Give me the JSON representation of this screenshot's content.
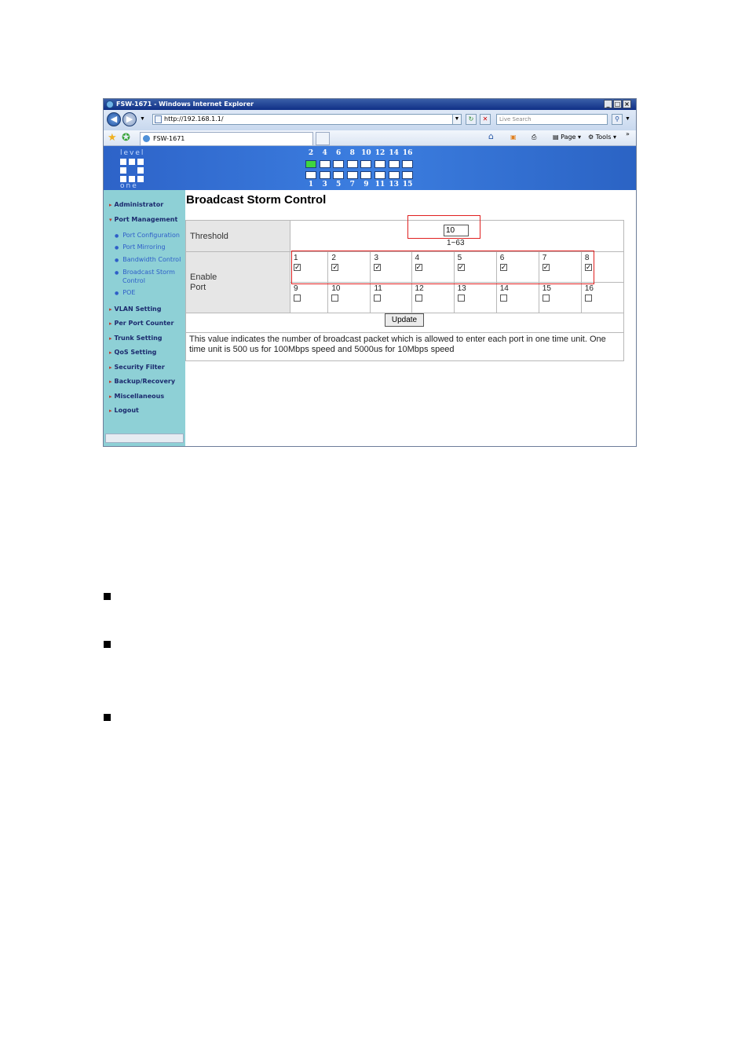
{
  "window": {
    "title": "FSW-1671 - Windows Internet Explorer",
    "url": "http://192.168.1.1/",
    "search_placeholder": "Live Search",
    "tab_title": "FSW-1671",
    "toolbar": {
      "page_label": "Page",
      "tools_label": "Tools"
    },
    "controls": {
      "minimize": "_",
      "maximize": "□",
      "close": "×"
    }
  },
  "banner": {
    "logo_top": "level",
    "logo_bottom": "one",
    "top_port_numbers": [
      "2",
      "4",
      "6",
      "8",
      "10",
      "12",
      "14",
      "16"
    ],
    "bottom_port_numbers": [
      "1",
      "3",
      "5",
      "7",
      "9",
      "11",
      "13",
      "15"
    ],
    "active_port": "2"
  },
  "sidebar": {
    "administrator": "Administrator",
    "port_management": "Port Management",
    "submenu": {
      "port_configuration": "Port Configuration",
      "port_mirroring": "Port Mirroring",
      "bandwidth_control": "Bandwidth Control",
      "broadcast_storm_1": "Broadcast Storm",
      "broadcast_storm_2": "Control",
      "poe": "POE"
    },
    "vlan_setting": "VLAN Setting",
    "per_port_counter": "Per Port Counter",
    "trunk_setting": "Trunk Setting",
    "qos_setting": "QoS Setting",
    "security_filter": "Security Filter",
    "backup_recovery": "Backup/Recovery",
    "miscellaneous": "Miscellaneous",
    "logout": "Logout"
  },
  "main": {
    "title": "Broadcast Storm Control",
    "threshold_label": "Threshold",
    "threshold_value": "10",
    "threshold_range": "1~63",
    "enable_port_label_1": "Enable",
    "enable_port_label_2": "Port",
    "ports_row1": [
      {
        "num": "1",
        "checked": true
      },
      {
        "num": "2",
        "checked": true
      },
      {
        "num": "3",
        "checked": true
      },
      {
        "num": "4",
        "checked": true
      },
      {
        "num": "5",
        "checked": true
      },
      {
        "num": "6",
        "checked": true
      },
      {
        "num": "7",
        "checked": true
      },
      {
        "num": "8",
        "checked": true
      }
    ],
    "ports_row2": [
      {
        "num": "9",
        "checked": false
      },
      {
        "num": "10",
        "checked": false
      },
      {
        "num": "11",
        "checked": false
      },
      {
        "num": "12",
        "checked": false
      },
      {
        "num": "13",
        "checked": false
      },
      {
        "num": "14",
        "checked": false
      },
      {
        "num": "15",
        "checked": false
      },
      {
        "num": "16",
        "checked": false
      }
    ],
    "update_button": "Update",
    "note": "This value indicates the number of broadcast packet which is allowed to enter each port in one time unit. One time unit is 500 us for 100Mbps speed and 5000us for 10Mbps speed"
  },
  "colors": {
    "banner": "#2d63c8",
    "sidebar": "#8ed0d6",
    "highlight": "#e02020",
    "active_port": "#3fd63f"
  }
}
